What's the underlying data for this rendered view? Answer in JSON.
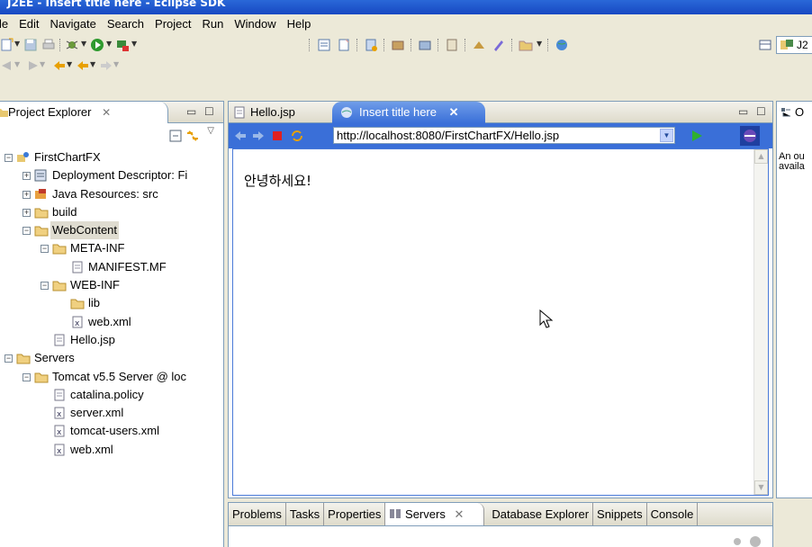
{
  "window": {
    "title": "J2EE - Insert title here - Eclipse SDK"
  },
  "menu": [
    "le",
    "Edit",
    "Navigate",
    "Search",
    "Project",
    "Run",
    "Window",
    "Help"
  ],
  "toolbar": {
    "perspective_label": "J2"
  },
  "project_explorer": {
    "tab_label": "Project Explorer",
    "tab_close": "✕",
    "tree": [
      {
        "label": "FirstChartFX",
        "level": 0,
        "expanded": true,
        "icon": "project-icon"
      },
      {
        "label": "Deployment Descriptor: Fi",
        "level": 1,
        "expanded": false,
        "icon": "deployment-descriptor-icon"
      },
      {
        "label": "Java Resources: src",
        "level": 1,
        "expanded": false,
        "icon": "java-resources-icon"
      },
      {
        "label": "build",
        "level": 1,
        "expanded": false,
        "icon": "folder-icon"
      },
      {
        "label": "WebContent",
        "level": 1,
        "expanded": true,
        "icon": "folder-icon",
        "selected": true
      },
      {
        "label": "META-INF",
        "level": 2,
        "expanded": true,
        "icon": "folder-icon"
      },
      {
        "label": "MANIFEST.MF",
        "level": 3,
        "icon": "file-icon"
      },
      {
        "label": "WEB-INF",
        "level": 2,
        "expanded": true,
        "icon": "folder-icon"
      },
      {
        "label": "lib",
        "level": 3,
        "icon": "folder-icon"
      },
      {
        "label": "web.xml",
        "level": 3,
        "icon": "xml-file-icon"
      },
      {
        "label": "Hello.jsp",
        "level": 2,
        "icon": "jsp-file-icon"
      },
      {
        "label": "Servers",
        "level": 0,
        "expanded": true,
        "icon": "folder-icon"
      },
      {
        "label": "Tomcat v5.5 Server @ loc",
        "level": 1,
        "expanded": true,
        "icon": "folder-icon"
      },
      {
        "label": "catalina.policy",
        "level": 2,
        "icon": "file-icon"
      },
      {
        "label": "server.xml",
        "level": 2,
        "icon": "xml-file-icon"
      },
      {
        "label": "tomcat-users.xml",
        "level": 2,
        "icon": "xml-file-icon"
      },
      {
        "label": "web.xml",
        "level": 2,
        "icon": "xml-file-icon"
      }
    ]
  },
  "editor": {
    "tabs": [
      {
        "label": "Hello.jsp",
        "active": false
      },
      {
        "label": "Insert title here",
        "active": true,
        "close": "✕"
      }
    ],
    "browser": {
      "url": "http://localhost:8080/FirstChartFX/Hello.jsp",
      "page_text": "안녕하세요!"
    }
  },
  "outline": {
    "tab_label": "O",
    "text_line1": "An ou",
    "text_line2": "availa"
  },
  "bottom": {
    "tabs": [
      "Problems",
      "Tasks",
      "Properties",
      "Servers",
      "Database Explorer",
      "Snippets",
      "Console"
    ],
    "active_tab": "Servers",
    "active_close": "✕"
  }
}
